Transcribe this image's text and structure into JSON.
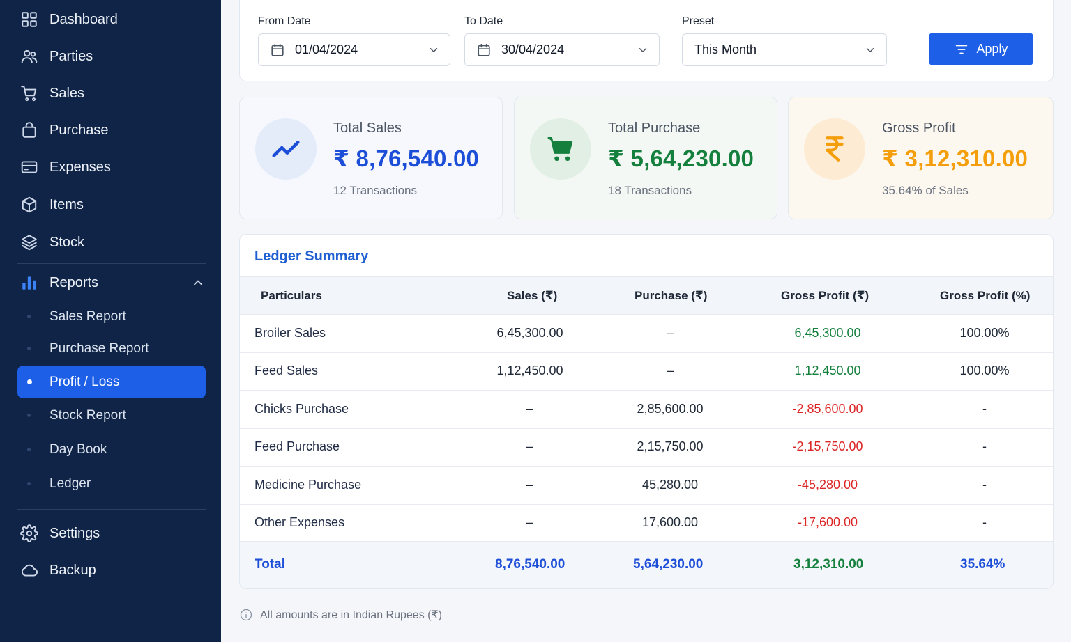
{
  "sidebar": {
    "items": [
      {
        "label": "Dashboard",
        "icon": "grid-icon"
      },
      {
        "label": "Parties",
        "icon": "users-icon"
      },
      {
        "label": "Sales",
        "icon": "cart-icon"
      },
      {
        "label": "Purchase",
        "icon": "bag-icon"
      },
      {
        "label": "Expenses",
        "icon": "card-icon"
      },
      {
        "label": "Items",
        "icon": "box-icon"
      },
      {
        "label": "Stock",
        "icon": "layers-icon"
      }
    ],
    "reports": {
      "label": "Reports",
      "icon": "bar-chart-icon"
    },
    "sub_items": [
      "Sales Report",
      "Purchase Report",
      "Profit / Loss",
      "Stock Report",
      "Day Book",
      "Ledger"
    ],
    "bottom": [
      {
        "label": "Settings",
        "icon": "gear-icon"
      },
      {
        "label": "Backup",
        "icon": "cloud-icon"
      }
    ],
    "active_color": "#1d5fe6"
  },
  "filters": {
    "from_label": "From Date",
    "from_value": "01/04/2024",
    "to_label": "To Date",
    "to_value": "30/04/2024",
    "preset_label": "Preset",
    "preset_value": "This Month",
    "apply_label": "Apply"
  },
  "stats": [
    {
      "title": "Total Sales",
      "value": "₹ 8,76,540.00",
      "sub": "12 Transactions",
      "color": "#1d4ed8",
      "icon": "trend-up-icon"
    },
    {
      "title": "Total Purchase",
      "value": "₹ 5,64,230.00",
      "sub": "18 Transactions",
      "color": "#15803d",
      "icon": "cart-icon"
    },
    {
      "title": "Gross Profit",
      "value": "₹ 3,12,310.00",
      "sub": "35.64% of Sales",
      "color": "#f59e0b",
      "icon": "rupee-icon"
    }
  ],
  "ledger": {
    "title": "Ledger Summary",
    "columns": [
      "Particulars",
      "Sales (₹)",
      "Purchase (₹)",
      "Gross Profit (₹)",
      "Gross Profit (%)"
    ],
    "rows": [
      {
        "name": "Broiler Sales",
        "sales": "6,45,300.00",
        "purchase": "–",
        "profit": "6,45,300.00",
        "pct": "100.00%",
        "profit_positive": true
      },
      {
        "name": "Feed Sales",
        "sales": "1,12,450.00",
        "purchase": "–",
        "profit": "1,12,450.00",
        "pct": "100.00%",
        "profit_positive": true
      },
      {
        "name": "Chicks Purchase",
        "sales": "–",
        "purchase": "2,85,600.00",
        "profit": "-2,85,600.00",
        "pct": "-",
        "profit_positive": false
      },
      {
        "name": "Feed Purchase",
        "sales": "–",
        "purchase": "2,15,750.00",
        "profit": "-2,15,750.00",
        "pct": "-",
        "profit_positive": false
      },
      {
        "name": "Medicine Purchase",
        "sales": "–",
        "purchase": "45,280.00",
        "profit": "-45,280.00",
        "pct": "-",
        "profit_positive": false
      },
      {
        "name": "Other Expenses",
        "sales": "–",
        "purchase": "17,600.00",
        "profit": "-17,600.00",
        "pct": "-",
        "profit_positive": false
      }
    ],
    "total": {
      "label": "Total",
      "sales": "8,76,540.00",
      "purchase": "5,64,230.00",
      "profit": "3,12,310.00",
      "pct": "35.64%"
    },
    "colors": {
      "positive": "#15803d",
      "negative": "#dc2626",
      "total_blue": "#1d4ed8"
    }
  },
  "note": "All amounts are in Indian Rupees (₹)"
}
